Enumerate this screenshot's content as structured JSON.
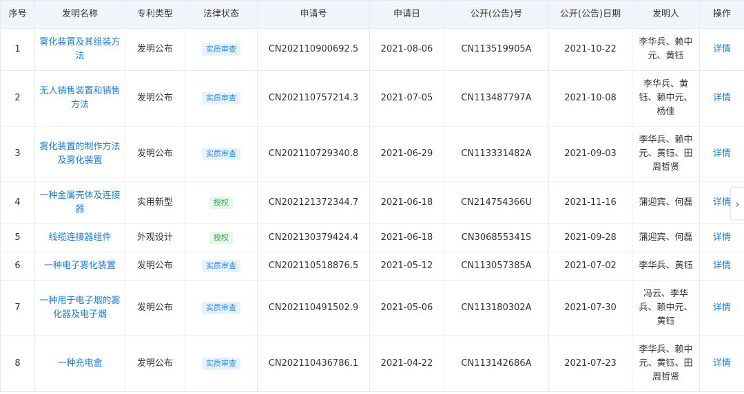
{
  "columns": [
    "序号",
    "发明名称",
    "专利类型",
    "法律状态",
    "申请号",
    "申请日",
    "公开(公告)号",
    "公开(公告)日期",
    "发明人",
    "操作"
  ],
  "rows": [
    {
      "no": "1",
      "title": "雾化装置及其组装方法",
      "type": "发明公布",
      "status": "实质审查",
      "status_kind": "review",
      "app_no": "CN202110900692.5",
      "app_date": "2021-08-06",
      "pub_no": "CN113519905A",
      "pub_date": "2021-10-22",
      "inventors": "李华兵、赖中元、黄钰",
      "action": "详情"
    },
    {
      "no": "2",
      "title": "无人销售装置和销售方法",
      "type": "发明公布",
      "status": "实质审查",
      "status_kind": "review",
      "app_no": "CN202110757214.3",
      "app_date": "2021-07-05",
      "pub_no": "CN113487797A",
      "pub_date": "2021-10-08",
      "inventors": "李华兵、黄钰、赖中元、杨佳",
      "action": "详情"
    },
    {
      "no": "3",
      "title": "雾化装置的制作方法及雾化装置",
      "type": "发明公布",
      "status": "实质审查",
      "status_kind": "review",
      "app_no": "CN202110729340.8",
      "app_date": "2021-06-29",
      "pub_no": "CN113331482A",
      "pub_date": "2021-09-03",
      "inventors": "李华兵、赖中元、黄钰、田周哲贤",
      "action": "详情"
    },
    {
      "no": "4",
      "title": "一种金属壳体及连接器",
      "type": "实用新型",
      "status": "授权",
      "status_kind": "grant",
      "app_no": "CN202121372344.7",
      "app_date": "2021-06-18",
      "pub_no": "CN214754366U",
      "pub_date": "2021-11-16",
      "inventors": "蒲迎宾、何磊",
      "action": "详情"
    },
    {
      "no": "5",
      "title": "线缆连接器组件",
      "type": "外观设计",
      "status": "授权",
      "status_kind": "grant",
      "app_no": "CN202130379424.4",
      "app_date": "2021-06-18",
      "pub_no": "CN306855341S",
      "pub_date": "2021-09-28",
      "inventors": "蒲迎宾、何磊",
      "action": "详情"
    },
    {
      "no": "6",
      "title": "一种电子雾化装置",
      "type": "发明公布",
      "status": "实质审查",
      "status_kind": "review",
      "app_no": "CN202110518876.5",
      "app_date": "2021-05-12",
      "pub_no": "CN113057385A",
      "pub_date": "2021-07-02",
      "inventors": "李华兵、黄钰",
      "action": "详情"
    },
    {
      "no": "7",
      "title": "一种用于电子烟的雾化器及电子烟",
      "type": "发明公布",
      "status": "实质审查",
      "status_kind": "review",
      "app_no": "CN202110491502.9",
      "app_date": "2021-05-06",
      "pub_no": "CN113180302A",
      "pub_date": "2021-07-30",
      "inventors": "冯云、李华兵、赖中元、黄钰",
      "action": "详情"
    },
    {
      "no": "8",
      "title": "一种充电盒",
      "type": "发明公布",
      "status": "实质审查",
      "status_kind": "review",
      "app_no": "CN202110436786.1",
      "app_date": "2021-04-22",
      "pub_no": "CN113142686A",
      "pub_date": "2021-07-23",
      "inventors": "李华兵、赖中元、黄钰、田周哲贤",
      "action": "详情"
    }
  ],
  "colors": {
    "link": "#1a7fd6",
    "header_bg": "#f1f5fb",
    "review_tag_bg": "#e6f2fd",
    "grant_tag_bg": "#e7f8ea"
  },
  "icons": {
    "scroll_next": "chevron-right-icon"
  }
}
